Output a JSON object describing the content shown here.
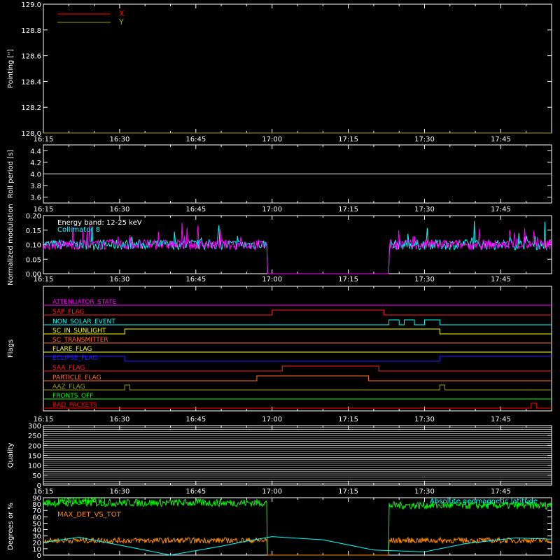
{
  "x_axis": {
    "tick_labels": [
      "16:15",
      "16:30",
      "16:45",
      "17:00",
      "17:15",
      "17:30",
      "17:45"
    ]
  },
  "panels": [
    {
      "id": "pointing",
      "ylabel": "Pointing [\"]",
      "ylim": [
        128.0,
        129.0
      ],
      "yticks": [
        "128.0",
        "128.2",
        "128.4",
        "128.6",
        "128.8",
        "129.0"
      ]
    },
    {
      "id": "roll",
      "ylabel": "Roll period [s]",
      "ylim": [
        3.5,
        4.5
      ],
      "yticks": [
        "3.6",
        "3.8",
        "4.0",
        "4.2",
        "4.4"
      ]
    },
    {
      "id": "modulation",
      "ylabel": "Normalized modulation",
      "ylim": [
        0.0,
        0.2
      ],
      "yticks": [
        "0.00",
        "0.05",
        "0.10",
        "0.15",
        "0.20"
      ]
    },
    {
      "id": "flags",
      "ylabel": "Flags"
    },
    {
      "id": "quality",
      "ylabel": "Quality",
      "ylim": [
        0,
        300
      ],
      "yticks": [
        "0",
        "50",
        "100",
        "150",
        "200",
        "250",
        "300"
      ]
    },
    {
      "id": "latitude",
      "ylabel": "Degrees or %",
      "ylim": [
        0,
        90
      ],
      "yticks": [
        "0",
        "10",
        "20",
        "30",
        "40",
        "50",
        "60",
        "70",
        "80",
        "90"
      ]
    }
  ],
  "legends": {
    "pointing": [
      {
        "label": "X",
        "color": "#ff0000"
      },
      {
        "label": "Y",
        "color": "#a0a000"
      }
    ],
    "modulation": [
      {
        "label": "Energy band: 12-25 keV",
        "color": "#ffffff"
      },
      {
        "label": "Collimator 8",
        "color": "#00ffff"
      }
    ],
    "latitude": [
      {
        "label": "FRONT_RATIO",
        "color": "#00ff00"
      },
      {
        "label": "MAX_DET_VS_TOT",
        "color": "#ff8c00"
      },
      {
        "label": "Absolute geomagnetic latitude",
        "color": "#00ffff"
      }
    ]
  },
  "chart_data": [
    {
      "type": "line",
      "title": "",
      "xlabel": "",
      "ylabel": "Pointing [\"]",
      "xlim": [
        "16:15",
        "17:55"
      ],
      "ylim": [
        128.0,
        129.0
      ],
      "series": [
        {
          "name": "X",
          "color": "#ff0000",
          "x": [
            "16:15",
            "17:55"
          ],
          "values": [
            128.0,
            128.0
          ]
        },
        {
          "name": "Y",
          "color": "#a0a000",
          "x": [
            "16:15",
            "17:55"
          ],
          "values": [
            128.0,
            128.0
          ]
        }
      ]
    },
    {
      "type": "line",
      "ylabel": "Roll period [s]",
      "ylim": [
        3.5,
        4.5
      ],
      "series": [
        {
          "color": "#ffffff",
          "x": [
            "16:15",
            "17:55"
          ],
          "values": [
            4.0,
            4.0
          ]
        }
      ]
    },
    {
      "type": "line",
      "ylabel": "Normalized modulation",
      "ylim": [
        0.0,
        0.2
      ],
      "series": [
        {
          "name": "Collimator 8",
          "color": "#00ffff",
          "x": [
            "16:15",
            "16:30",
            "16:45",
            "16:59",
            "17:00",
            "17:22",
            "17:23",
            "17:30",
            "17:45",
            "17:55"
          ],
          "values": [
            0.1,
            0.1,
            0.1,
            0.1,
            0.0,
            0.0,
            0.1,
            0.1,
            0.1,
            0.1
          ]
        },
        {
          "color": "#ff00ff",
          "x": [
            "16:15",
            "16:30",
            "16:45",
            "16:59",
            "17:00",
            "17:22",
            "17:23",
            "17:30",
            "17:45",
            "17:55"
          ],
          "values": [
            0.1,
            0.1,
            0.1,
            0.1,
            0.0,
            0.0,
            0.1,
            0.1,
            0.1,
            0.1
          ]
        }
      ]
    },
    {
      "type": "line",
      "ylabel": "Flags",
      "flags": [
        {
          "name": "ATTENUATOR_STATE",
          "color": "#ff00ff",
          "transitions": []
        },
        {
          "name": "SAP_FLAG",
          "color": "#ff2020",
          "transitions": [
            [
              "17:00",
              1
            ],
            [
              "17:22",
              0
            ]
          ]
        },
        {
          "name": "NON_SOLAR_EVENT",
          "color": "#00ffff",
          "transitions": [
            [
              "17:23",
              1
            ],
            [
              "17:25",
              0
            ],
            [
              "17:26",
              1
            ],
            [
              "17:28",
              0
            ],
            [
              "17:30",
              1
            ],
            [
              "17:33",
              0
            ]
          ]
        },
        {
          "name": "SC_IN_SUNLIGHT",
          "color": "#ffff00",
          "transitions": [
            [
              "16:31",
              1
            ],
            [
              "17:33",
              0
            ]
          ]
        },
        {
          "name": "SC_TRANSMITTER",
          "color": "#ff6a30",
          "transitions": []
        },
        {
          "name": "FLARE_FLAG",
          "color": "#ffff40",
          "transitions": []
        },
        {
          "name": "ECLIPSE_FLAG",
          "color": "#2020ff",
          "transitions": [
            [
              "16:31",
              0
            ],
            [
              "17:33",
              1
            ]
          ]
        },
        {
          "name": "SAA_FLAG",
          "color": "#ff2020",
          "transitions": [
            [
              "17:02",
              1
            ],
            [
              "17:21",
              0
            ]
          ]
        },
        {
          "name": "PARTICLE_FLAG",
          "color": "#ff6a30",
          "transitions": [
            [
              "16:57",
              1
            ],
            [
              "17:19",
              0
            ]
          ]
        },
        {
          "name": "AAZ_FLAG",
          "color": "#a0a000",
          "transitions": [
            [
              "16:31",
              1
            ],
            [
              "16:32",
              0
            ],
            [
              "17:33",
              1
            ],
            [
              "17:34",
              0
            ]
          ]
        },
        {
          "name": "FRONTS_OFF",
          "color": "#00ff00",
          "transitions": []
        },
        {
          "name": "BAD_PACKETS",
          "color": "#ff0000",
          "transitions": [
            [
              "17:51",
              1
            ],
            [
              "17:52",
              0
            ]
          ]
        }
      ]
    },
    {
      "type": "line",
      "ylabel": "Quality",
      "ylim": [
        0,
        300
      ],
      "series": []
    },
    {
      "type": "line",
      "ylabel": "Degrees or %",
      "ylim": [
        0,
        90
      ],
      "series": [
        {
          "name": "FRONT_RATIO",
          "color": "#00ff00",
          "x": [
            "16:15",
            "16:30",
            "16:45",
            "16:59",
            "17:00",
            "17:23",
            "17:24",
            "17:40",
            "17:55"
          ],
          "values": [
            82,
            82,
            82,
            83,
            0,
            0,
            75,
            79,
            80
          ]
        },
        {
          "name": "MAX_DET_VS_TOT",
          "color": "#ff8c00",
          "x": [
            "16:15",
            "16:30",
            "16:45",
            "16:59",
            "17:00",
            "17:23",
            "17:24",
            "17:40",
            "17:55"
          ],
          "values": [
            24,
            24,
            24,
            24,
            0,
            0,
            22,
            23,
            24
          ]
        },
        {
          "name": "Absolute geomagnetic latitude",
          "color": "#00ffff",
          "x": [
            "16:15",
            "16:22",
            "16:33",
            "16:40",
            "16:50",
            "16:55",
            "17:00",
            "17:10",
            "17:20",
            "17:30",
            "17:38",
            "17:48",
            "17:55"
          ],
          "values": [
            20,
            28,
            11,
            0,
            14,
            22,
            29,
            24,
            8,
            5,
            18,
            27,
            25
          ]
        }
      ]
    }
  ]
}
